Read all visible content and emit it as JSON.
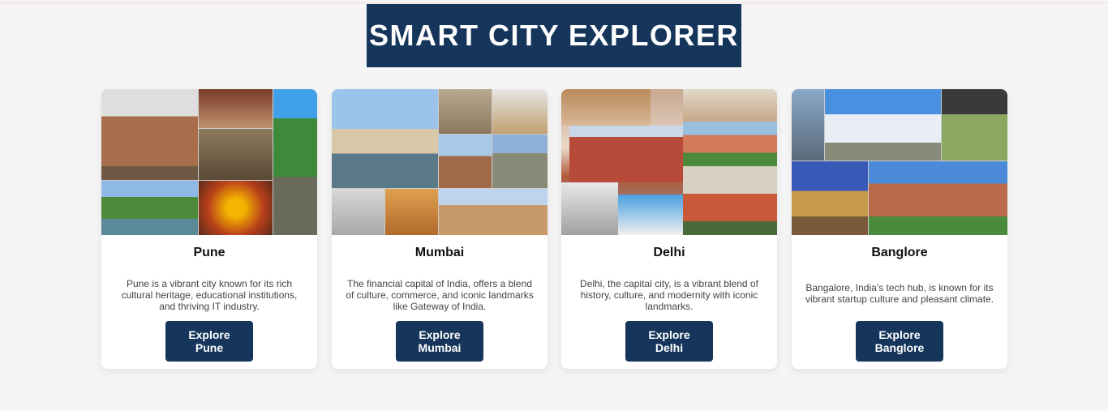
{
  "header": {
    "title": "SMART CITY EXPLORER"
  },
  "colors": {
    "primary": "#16355b",
    "background": "#f5f5f5",
    "card": "#ffffff"
  },
  "cities": [
    {
      "name": "Pune",
      "description": "Pune is a vibrant city known for its rich cultural heritage, educational institutions, and thriving IT industry.",
      "button_line1": "Explore",
      "button_line2": "Pune"
    },
    {
      "name": "Mumbai",
      "description": "The financial capital of India, offers a blend of culture, commerce, and iconic landmarks like Gateway of India.",
      "button_line1": "Explore",
      "button_line2": "Mumbai"
    },
    {
      "name": "Delhi",
      "description": "Delhi, the capital city, is a vibrant blend of history, culture, and modernity with iconic landmarks.",
      "button_line1": "Explore",
      "button_line2": "Delhi"
    },
    {
      "name": "Banglore",
      "description": "Bangalore, India’s tech hub, is known for its vibrant startup culture and pleasant climate.",
      "button_line1": "Explore",
      "button_line2": "Banglore"
    }
  ]
}
